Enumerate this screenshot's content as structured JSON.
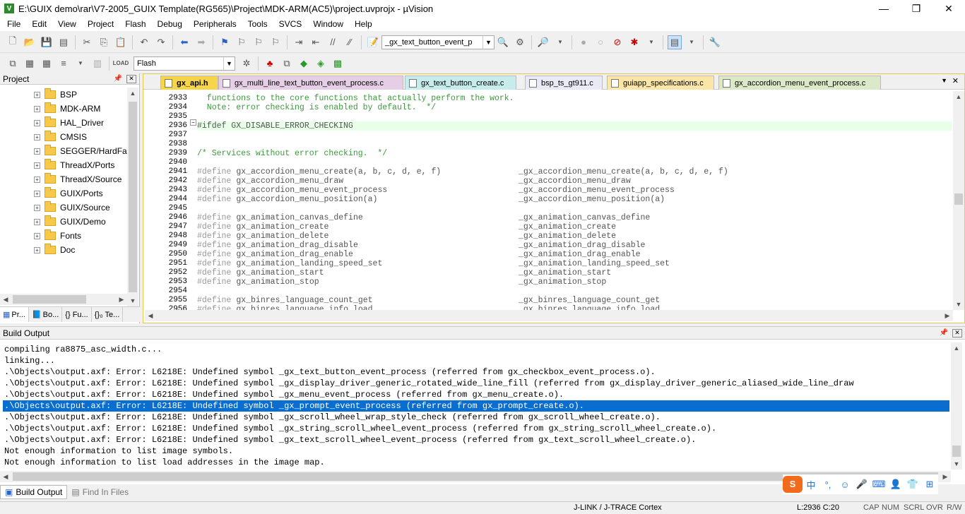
{
  "window": {
    "title": "E:\\GUIX demo\\rar\\V7-2005_GUIX Template(RG565)\\Project\\MDK-ARM(AC5)\\project.uvprojx - µVision",
    "minimize": "—",
    "maximize": "❐",
    "close": "✕"
  },
  "menu": [
    "File",
    "Edit",
    "View",
    "Project",
    "Flash",
    "Debug",
    "Peripherals",
    "Tools",
    "SVCS",
    "Window",
    "Help"
  ],
  "toolbar": {
    "function_combo": "_gx_text_button_event_p",
    "target_combo": "Flash"
  },
  "project": {
    "title": "Project",
    "folders": [
      "BSP",
      "MDK-ARM",
      "HAL_Driver",
      "CMSIS",
      "SEGGER/HardFau",
      "ThreadX/Ports",
      "ThreadX/Source",
      "GUIX/Ports",
      "GUIX/Source",
      "GUIX/Demo",
      "Fonts",
      "Doc"
    ],
    "tabs": [
      "Pr...",
      "Bo...",
      "{} Fu...",
      "{}₀ Te..."
    ]
  },
  "editor": {
    "tabs": [
      "gx_api.h",
      "gx_multi_line_text_button_event_process.c",
      "gx_text_button_create.c",
      "bsp_ts_gt911.c",
      "guiapp_specifications.c",
      "gx_accordion_menu_event_process.c"
    ],
    "lines": [
      {
        "n": "2933",
        "a": "  functions to the core functions that actually perform the work.",
        "b": "",
        "t": "cmt"
      },
      {
        "n": "2934",
        "a": "  Note: error checking is enabled by default.  */",
        "b": "",
        "t": "cmt"
      },
      {
        "n": "2935",
        "a": "",
        "b": "",
        "t": ""
      },
      {
        "n": "2936",
        "a": "#ifdef GX_DISABLE_ERROR_CHECKING",
        "b": "",
        "t": "hl"
      },
      {
        "n": "2937",
        "a": "",
        "b": "",
        "t": ""
      },
      {
        "n": "2938",
        "a": "",
        "b": "",
        "t": ""
      },
      {
        "n": "2939",
        "a": "/* Services without error checking.  */",
        "b": "",
        "t": "cmt"
      },
      {
        "n": "2940",
        "a": "",
        "b": "",
        "t": ""
      },
      {
        "n": "2941",
        "a": "gx_accordion_menu_create(a, b, c, d, e, f)",
        "b": "_gx_accordion_menu_create(a, b, c, d, e, f)",
        "t": "def"
      },
      {
        "n": "2942",
        "a": "gx_accordion_menu_draw",
        "b": "_gx_accordion_menu_draw",
        "t": "def"
      },
      {
        "n": "2943",
        "a": "gx_accordion_menu_event_process",
        "b": "_gx_accordion_menu_event_process",
        "t": "def"
      },
      {
        "n": "2944",
        "a": "gx_accordion_menu_position(a)",
        "b": "_gx_accordion_menu_position(a)",
        "t": "def"
      },
      {
        "n": "2945",
        "a": "",
        "b": "",
        "t": ""
      },
      {
        "n": "2946",
        "a": "gx_animation_canvas_define",
        "b": "_gx_animation_canvas_define",
        "t": "def"
      },
      {
        "n": "2947",
        "a": "gx_animation_create",
        "b": "_gx_animation_create",
        "t": "def"
      },
      {
        "n": "2948",
        "a": "gx_animation_delete",
        "b": "_gx_animation_delete",
        "t": "def"
      },
      {
        "n": "2949",
        "a": "gx_animation_drag_disable",
        "b": "_gx_animation_drag_disable",
        "t": "def"
      },
      {
        "n": "2950",
        "a": "gx_animation_drag_enable",
        "b": "_gx_animation_drag_enable",
        "t": "def"
      },
      {
        "n": "2951",
        "a": "gx_animation_landing_speed_set",
        "b": "_gx_animation_landing_speed_set",
        "t": "def"
      },
      {
        "n": "2952",
        "a": "gx_animation_start",
        "b": "_gx_animation_start",
        "t": "def"
      },
      {
        "n": "2953",
        "a": "gx_animation_stop",
        "b": "_gx_animation_stop",
        "t": "def"
      },
      {
        "n": "2954",
        "a": "",
        "b": "",
        "t": ""
      },
      {
        "n": "2955",
        "a": "gx_binres_language_count_get",
        "b": "_gx_binres_language_count_get",
        "t": "def"
      },
      {
        "n": "2956",
        "a": "gx_binres_language_info_load",
        "b": "_gx_binres_language_info_load",
        "t": "def"
      }
    ],
    "define_kw": "#define"
  },
  "build": {
    "title": "Build Output",
    "lines": [
      "compiling ra8875_asc_width.c...",
      "linking...",
      ".\\Objects\\output.axf: Error: L6218E: Undefined symbol _gx_text_button_event_process (referred from gx_checkbox_event_process.o).",
      ".\\Objects\\output.axf: Error: L6218E: Undefined symbol _gx_display_driver_generic_rotated_wide_line_fill (referred from gx_display_driver_generic_aliased_wide_line_draw",
      ".\\Objects\\output.axf: Error: L6218E: Undefined symbol _gx_menu_event_process (referred from gx_menu_create.o).",
      ".\\Objects\\output.axf: Error: L6218E: Undefined symbol _gx_prompt_event_process (referred from gx_prompt_create.o).",
      ".\\Objects\\output.axf: Error: L6218E: Undefined symbol _gx_scroll_wheel_wrap_style_check (referred from gx_scroll_wheel_create.o).",
      ".\\Objects\\output.axf: Error: L6218E: Undefined symbol _gx_string_scroll_wheel_event_process (referred from gx_string_scroll_wheel_create.o).",
      ".\\Objects\\output.axf: Error: L6218E: Undefined symbol _gx_text_scroll_wheel_event_process (referred from gx_text_scroll_wheel_create.o).",
      "Not enough information to list image symbols.",
      "Not enough information to list load addresses in the image map."
    ],
    "selected_index": 5,
    "tabs": [
      "Build Output",
      "Find In Files"
    ]
  },
  "status": {
    "debugger": "J-LINK / J-TRACE Cortex",
    "position": "L:2936 C:20",
    "caps": "CAP",
    "num": "NUM",
    "scrl": "SCRL",
    "ovr": "OVR",
    "rw": "R/W"
  },
  "ime": [
    "S",
    "中",
    "°,",
    "☺",
    "🎤",
    "⌨",
    "👤",
    "👕",
    "⊞"
  ],
  "colors": {
    "selection": "#0a6ed1",
    "comment": "#3a9a3a",
    "current_line": "#e8ffe8"
  }
}
